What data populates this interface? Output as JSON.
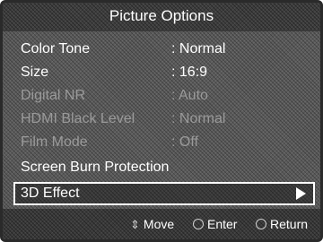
{
  "menu": {
    "title": "Picture Options",
    "items": [
      {
        "label": "Color Tone",
        "value": ": Normal"
      },
      {
        "label": "Size",
        "value": ": 16:9"
      },
      {
        "label": "Digital NR",
        "value": ": Auto"
      },
      {
        "label": "HDMI Black Level",
        "value": ": Normal"
      },
      {
        "label": "Film Mode",
        "value": ": Off"
      },
      {
        "label": "Screen Burn Protection",
        "value": ""
      },
      {
        "label": "3D Effect",
        "value": ""
      }
    ]
  },
  "footer": {
    "move_label": "Move",
    "enter_label": "Enter",
    "return_label": "Return",
    "move_icon": "up-down-arrows-icon",
    "enter_icon": "enter-circle-icon",
    "return_icon": "return-circle-icon"
  },
  "colors": {
    "text_enabled": "#ffffff",
    "text_disabled": "#9a9a9a",
    "selection_border": "#ffffff",
    "background": "#5a5a5a"
  }
}
